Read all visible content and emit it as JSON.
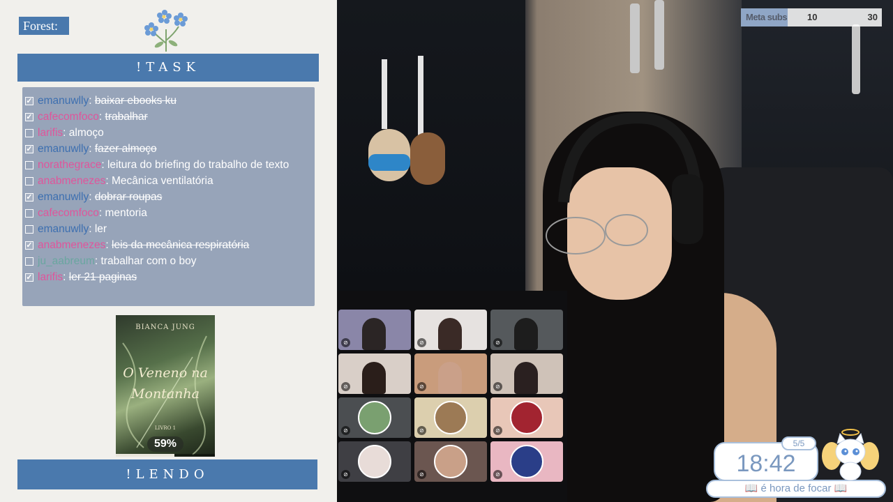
{
  "sidebar": {
    "forest_label": "Forest:",
    "task_banner": "!TASK",
    "lendo_banner": "!LENDO"
  },
  "tasks": [
    {
      "user": "emanuwlly",
      "user_color": "#3d6fb0",
      "task": "baixar ebooks ku",
      "done": true
    },
    {
      "user": "cafecomfoco",
      "user_color": "#e0559b",
      "task": "trabalhar",
      "done": true
    },
    {
      "user": "larifis",
      "user_color": "#e0559b",
      "task": "almoço",
      "done": false
    },
    {
      "user": "emanuwlly",
      "user_color": "#3d6fb0",
      "task": "fazer almoço",
      "done": true
    },
    {
      "user": "norathegrace",
      "user_color": "#e0559b",
      "task": "leitura do briefing do trabalho de texto",
      "done": false
    },
    {
      "user": "anabmenezes",
      "user_color": "#e0559b",
      "task": "Mecânica ventilatória",
      "done": false
    },
    {
      "user": "emanuwlly",
      "user_color": "#3d6fb0",
      "task": "dobrar roupas",
      "done": true
    },
    {
      "user": "cafecomfoco",
      "user_color": "#e0559b",
      "task": "mentoria",
      "done": false
    },
    {
      "user": "emanuwlly",
      "user_color": "#3d6fb0",
      "task": "ler",
      "done": false
    },
    {
      "user": "anabmenezes",
      "user_color": "#e0559b",
      "task": "leis da mecânica respiratória",
      "done": true
    },
    {
      "user": "ju_aabreum",
      "user_color": "#6aa6a0",
      "task": "trabalhar com o boy",
      "done": false
    },
    {
      "user": "larifis",
      "user_color": "#e0559b",
      "task": "ler 21 paginas",
      "done": true
    }
  ],
  "book": {
    "author": "BIANCA JUNG",
    "title": "O Veneno na Montanha",
    "series": "LIVRO 1",
    "progress_label": "59%",
    "progress": 0.59
  },
  "meta_subs": {
    "label": "Meta subs",
    "current": "10",
    "goal": "30",
    "progress": 0.33
  },
  "timer": {
    "time": "18:42",
    "session": "5/5",
    "message": "📖 é hora de focar 📖"
  },
  "call_tiles": [
    {
      "name": "participant-1",
      "bg": "#8a86a8",
      "type": "video",
      "fig": "#2b2525"
    },
    {
      "name": "participant-2",
      "bg": "#e6e2e0",
      "type": "video",
      "fig": "#3a2a26"
    },
    {
      "name": "participant-3",
      "bg": "#55595c",
      "type": "video",
      "fig": "#1d1d1d"
    },
    {
      "name": "participant-4",
      "bg": "#d9cfc8",
      "type": "video",
      "fig": "#2a1e1a"
    },
    {
      "name": "participant-5",
      "bg": "#c99c7c",
      "type": "video",
      "fig": "#caa089"
    },
    {
      "name": "participant-6",
      "bg": "#cfc2b8",
      "type": "video",
      "fig": "#2a2020"
    },
    {
      "name": "participant-7",
      "bg": "#4b4e51",
      "type": "avatar",
      "fig": "#7aa070"
    },
    {
      "name": "participant-8",
      "bg": "#dccfae",
      "type": "avatar",
      "fig": "#9c7a55"
    },
    {
      "name": "participant-9",
      "bg": "#e8c7b8",
      "type": "avatar",
      "fig": "#a22430"
    },
    {
      "name": "participant-10",
      "bg": "#3f3f44",
      "type": "avatar",
      "fig": "#e8dcd8"
    },
    {
      "name": "participant-11",
      "bg": "#6b5650",
      "type": "avatar",
      "fig": "#c9a088"
    },
    {
      "name": "participant-12",
      "bg": "#e9b7c2",
      "type": "avatar",
      "fig": "#2a3e88"
    }
  ]
}
